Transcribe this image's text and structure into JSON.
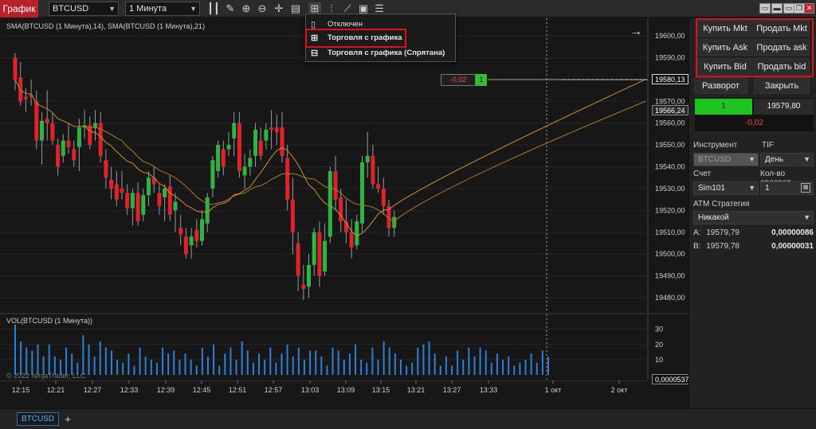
{
  "toolbar": {
    "chart_tab": "График",
    "instrument": "BTCUSD",
    "interval": "1 Минута",
    "icons": [
      "bar-style-icon",
      "draw-icon",
      "zoom-in-icon",
      "zoom-out-icon",
      "crosshair-icon",
      "properties-icon",
      "chart-trader-icon",
      "bars-icon",
      "strategy-icon",
      "indicators-icon",
      "list-icon"
    ],
    "window_icons": [
      "minimize-icon",
      "restore-icon",
      "maximize-icon",
      "close-icon"
    ]
  },
  "chart": {
    "indicator_label": "SMA(BTCUSD (1 Минута),14), SMA(BTCUSD (1 Минута),21)",
    "volume_label": "VOL(BTCUSD (1 Минута))",
    "copyright": "© 2022 NinjaTrader, LLC",
    "order_flag": {
      "pnl": "-0,02",
      "qty": "1"
    },
    "current_price_tag": "19580,13",
    "ask_tag": "19566,24",
    "volume_tag": "0,0000537",
    "price_ticks": [
      "19600,00",
      "19590,00",
      "19570,00",
      "19560,00",
      "19550,00",
      "19540,00",
      "19530,00",
      "19520,00",
      "19510,00",
      "19500,00",
      "19490,00",
      "19480,00"
    ],
    "volume_ticks": [
      "30",
      "20",
      "10"
    ],
    "time_ticks": [
      "12:15",
      "12:21",
      "12:27",
      "12:33",
      "12:39",
      "12:45",
      "12:51",
      "12:57",
      "13:03",
      "13:09",
      "13:15",
      "13:21",
      "13:27",
      "13:33",
      "1 окт",
      "2 окт"
    ],
    "colors": {
      "up": "#2fb344",
      "down": "#e0222a",
      "sma_fast": "#d0902e",
      "sma_slow": "#b07a2a",
      "volume": "#2e7fd8"
    }
  },
  "menu": {
    "items": [
      {
        "label": "Отключен",
        "icon": "chart-trader-off-icon"
      },
      {
        "label": "Торговля с графика",
        "icon": "chart-trader-icon"
      },
      {
        "label": "Торговля с графика (Спрятана)",
        "icon": "chart-trader-hidden-icon"
      }
    ]
  },
  "trader": {
    "buy_mkt": "Купить Mkt",
    "sell_mkt": "Продать Mkt",
    "buy_ask": "Купить Ask",
    "sell_ask": "Продать ask",
    "buy_bid": "Купить Bid",
    "sell_bid": "Продать bid",
    "reverse": "Разворот",
    "close": "Закрыть",
    "position": {
      "qty": "1",
      "avg_price": "19579,80",
      "pnl": "-0,02"
    },
    "instrument_label": "Инструмент",
    "tif_label": "TIF",
    "instrument_value": "BTCUSD",
    "tif_value": "День",
    "account_label": "Счет",
    "qty_label": "Кол-во ордеров",
    "account_value": "Sim101",
    "qty_value": "1",
    "atm_label": "ATM Стратегия",
    "atm_value": "Никакой",
    "ask_row": {
      "label": "A:",
      "price": "19579,79",
      "size": "0,00000086"
    },
    "bid_row": {
      "label": "B:",
      "price": "19579,78",
      "size": "0,00000031"
    }
  },
  "bottom": {
    "tab": "BTCUSD"
  },
  "chart_data": {
    "type": "candlestick",
    "title": "",
    "ylabel": "",
    "ylim": [
      19474,
      19606
    ],
    "candles": [
      [
        19590,
        19592,
        19575,
        19580
      ],
      [
        19581,
        19588,
        19568,
        19570
      ],
      [
        19572,
        19576,
        19565,
        19571
      ],
      [
        19573,
        19580,
        19568,
        19572
      ],
      [
        19570,
        19575,
        19548,
        19552
      ],
      [
        19552,
        19565,
        19541,
        19561
      ],
      [
        19562,
        19575,
        19552,
        19560
      ],
      [
        19560,
        19565,
        19550,
        19552
      ],
      [
        19550,
        19553,
        19536,
        19540
      ],
      [
        19545,
        19555,
        19542,
        19552
      ],
      [
        19552,
        19560,
        19546,
        19549
      ],
      [
        19548,
        19552,
        19540,
        19543
      ],
      [
        19549,
        19562,
        19538,
        19558
      ],
      [
        19558,
        19566,
        19553,
        19559
      ],
      [
        19559,
        19563,
        19548,
        19550
      ],
      [
        19558,
        19566,
        19552,
        19560
      ],
      [
        19560,
        19565,
        19542,
        19545
      ],
      [
        19543,
        19548,
        19530,
        19535
      ],
      [
        19534,
        19540,
        19525,
        19530
      ],
      [
        19532,
        19538,
        19522,
        19525
      ],
      [
        19530,
        19538,
        19525,
        19528
      ],
      [
        19528,
        19532,
        19518,
        19521
      ],
      [
        19521,
        19530,
        19513,
        19528
      ],
      [
        19528,
        19533,
        19513,
        19515
      ],
      [
        19518,
        19530,
        19515,
        19527
      ],
      [
        19527,
        19538,
        19522,
        19535
      ],
      [
        19535,
        19540,
        19528,
        19532
      ],
      [
        19528,
        19532,
        19518,
        19522
      ],
      [
        19526,
        19532,
        19515,
        19530
      ],
      [
        19531,
        19536,
        19515,
        19518
      ],
      [
        19520,
        19528,
        19510,
        19524
      ],
      [
        19512,
        19518,
        19504,
        19509
      ],
      [
        19508,
        19512,
        19498,
        19500
      ],
      [
        19504,
        19512,
        19498,
        19508
      ],
      [
        19511,
        19516,
        19503,
        19506
      ],
      [
        19506,
        19520,
        19504,
        19516
      ],
      [
        19514,
        19528,
        19510,
        19526
      ],
      [
        19530,
        19545,
        19526,
        19543
      ],
      [
        19538,
        19552,
        19535,
        19550
      ],
      [
        19548,
        19552,
        19536,
        19540
      ],
      [
        19548,
        19556,
        19545,
        19550
      ],
      [
        19553,
        19565,
        19545,
        19560
      ],
      [
        19560,
        19565,
        19535,
        19538
      ],
      [
        19536,
        19546,
        19530,
        19540
      ],
      [
        19540,
        19548,
        19536,
        19544
      ],
      [
        19545,
        19560,
        19540,
        19557
      ],
      [
        19552,
        19558,
        19543,
        19545
      ],
      [
        19552,
        19560,
        19548,
        19557
      ],
      [
        19558,
        19566,
        19548,
        19557
      ],
      [
        19558,
        19564,
        19550,
        19556
      ],
      [
        19558,
        19565,
        19542,
        19545
      ],
      [
        19544,
        19550,
        19520,
        19525
      ],
      [
        19525,
        19535,
        19500,
        19510
      ],
      [
        19505,
        19510,
        19483,
        19490
      ],
      [
        19486,
        19495,
        19479,
        19484
      ],
      [
        19485,
        19500,
        19480,
        19495
      ],
      [
        19495,
        19512,
        19490,
        19510
      ],
      [
        19510,
        19515,
        19485,
        19490
      ],
      [
        19492,
        19514,
        19490,
        19506
      ],
      [
        19508,
        19540,
        19505,
        19538
      ],
      [
        19538,
        19545,
        19520,
        19525
      ],
      [
        19526,
        19530,
        19510,
        19515
      ],
      [
        19515,
        19525,
        19505,
        19510
      ],
      [
        19510,
        19516,
        19498,
        19503
      ],
      [
        19504,
        19518,
        19502,
        19515
      ],
      [
        19514,
        19545,
        19510,
        19542
      ],
      [
        19542,
        19556,
        19535,
        19545
      ],
      [
        19545,
        19550,
        19530,
        19532
      ],
      [
        19532,
        19540,
        19528,
        19530
      ],
      [
        19530,
        19535,
        19518,
        19522
      ],
      [
        19522,
        19525,
        19508,
        19512
      ],
      [
        19512,
        19520,
        19508,
        19517
      ]
    ],
    "volume": [
      33,
      22,
      18,
      16,
      20,
      12,
      20,
      12,
      10,
      18,
      14,
      8,
      26,
      20,
      12,
      22,
      18,
      16,
      10,
      8,
      14,
      6,
      18,
      12,
      10,
      8,
      18,
      14,
      16,
      10,
      14,
      10,
      6,
      18,
      12,
      20,
      6,
      14,
      18,
      10,
      22,
      16,
      8,
      14,
      10,
      18,
      8,
      14,
      20,
      12,
      18,
      10,
      16,
      16,
      12,
      6,
      18,
      16,
      10,
      14,
      20,
      10,
      8,
      18,
      10,
      22,
      18,
      14,
      10,
      6,
      8,
      18,
      20,
      22,
      14,
      6,
      12,
      6,
      16,
      10,
      18,
      12,
      18,
      16,
      8,
      14,
      10,
      12,
      6,
      8,
      10,
      14,
      8,
      16,
      12
    ]
  }
}
